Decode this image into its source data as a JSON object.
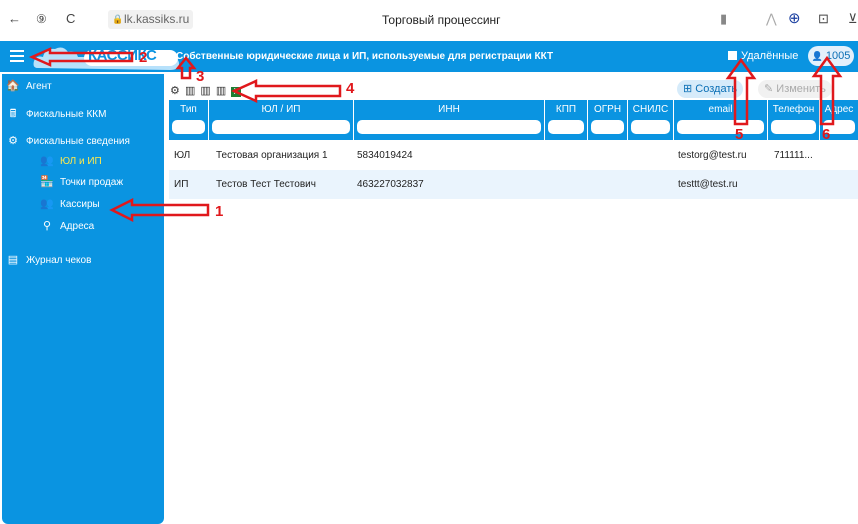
{
  "browser": {
    "url": "lk.kassiks.ru",
    "tab_title": "Торговый процессинг",
    "back_glyph": "←",
    "ya_glyph": "⑨",
    "reload_glyph": "C",
    "lock_glyph": "🔒",
    "bookmark_glyph": "▮",
    "extensions": [
      "⋀",
      "⊕",
      "⊡",
      "⊻"
    ]
  },
  "header": {
    "logo": "КАССИКС",
    "title": "Собственные юридические лица и ИП, используемые для регистрации ККТ",
    "deleted_label": "Удалённые",
    "user_id": "1005",
    "user_glyph": "👤"
  },
  "sidebar": {
    "items": [
      {
        "label": "Агент",
        "icon": "🏠"
      },
      {
        "label": "Фискальные ККМ",
        "icon": "🖩"
      },
      {
        "label": "Фискальные сведения",
        "icon": "⚙"
      },
      {
        "label": "ЮЛ и ИП",
        "icon": "👥"
      },
      {
        "label": "Точки продаж",
        "icon": "🏪"
      },
      {
        "label": "Кассиры",
        "icon": "👥"
      },
      {
        "label": "Адреса",
        "icon": "⚲"
      },
      {
        "label": "Журнал чеков",
        "icon": "▤"
      }
    ]
  },
  "toolbar": {
    "gear_glyph": "⚙",
    "cols_glyph": "▥",
    "xls_glyph": "X",
    "create_label": "Создать",
    "create_glyph": "⊞",
    "edit_label": "Изменить",
    "edit_glyph": "✎"
  },
  "table": {
    "columns": [
      "Тип",
      "ЮЛ / ИП",
      "ИНН",
      "КПП",
      "ОГРН",
      "СНИЛС",
      "email",
      "Телефон",
      "Адрес"
    ],
    "rows": [
      [
        "ЮЛ",
        "Тестовая организация 1",
        "5834019424",
        "",
        "",
        "",
        "testorg@test.ru",
        "711111...",
        ""
      ],
      [
        "ИП",
        "Тестов Тест Тестович",
        "463227032837",
        "",
        "",
        "",
        "testtt@test.ru",
        "",
        ""
      ]
    ]
  },
  "annotations": [
    "1",
    "2",
    "3",
    "4",
    "5",
    "6"
  ],
  "colors": {
    "accent": "#0a94e1",
    "active_item": "#ffe94d",
    "annotation": "#e0181c",
    "row_alt": "#eaf4fd"
  }
}
